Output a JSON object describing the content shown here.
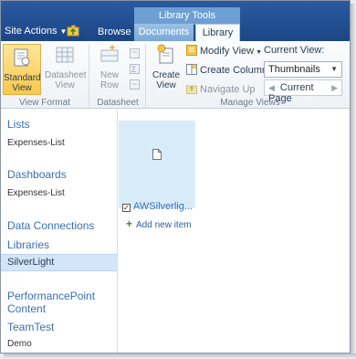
{
  "topbar": {
    "site_actions": "Site Actions",
    "contextual_group": "Library Tools",
    "tabs": [
      {
        "label": "Browse"
      },
      {
        "label": "Documents"
      },
      {
        "label": "Library"
      }
    ]
  },
  "ribbon": {
    "view_format": {
      "label": "View Format",
      "standard_view": "Standard View",
      "datasheet_view": "Datasheet View"
    },
    "datasheet": {
      "label": "Datasheet",
      "new_row": "New Row"
    },
    "manage_views": {
      "label": "Manage Views",
      "create_view": "Create View",
      "modify_view": "Modify View",
      "create_column": "Create Column",
      "navigate_up": "Navigate Up",
      "current_view_label": "Current View:",
      "current_view_value": "Thumbnails",
      "current_page": "Current Page"
    }
  },
  "leftnav": {
    "lists_heading": "Lists",
    "lists_item": "Expenses-List",
    "dashboards_heading": "Dashboards",
    "dashboards_item": "Expenses-List",
    "data_connections": "Data Connections",
    "libraries": "Libraries",
    "silverlight": "SilverLight",
    "performancepoint": "PerformancePoint Content",
    "teamtest": "TeamTest",
    "demo": "Demo"
  },
  "main": {
    "tile_name": "AWSilverlig...",
    "add_new_item": "Add new item"
  },
  "colors": {
    "topbar": "#1c4686",
    "accent_link": "#3a6fb3",
    "selected_nav": "#d3e5f8",
    "tile_bg": "#d8ebf9"
  }
}
